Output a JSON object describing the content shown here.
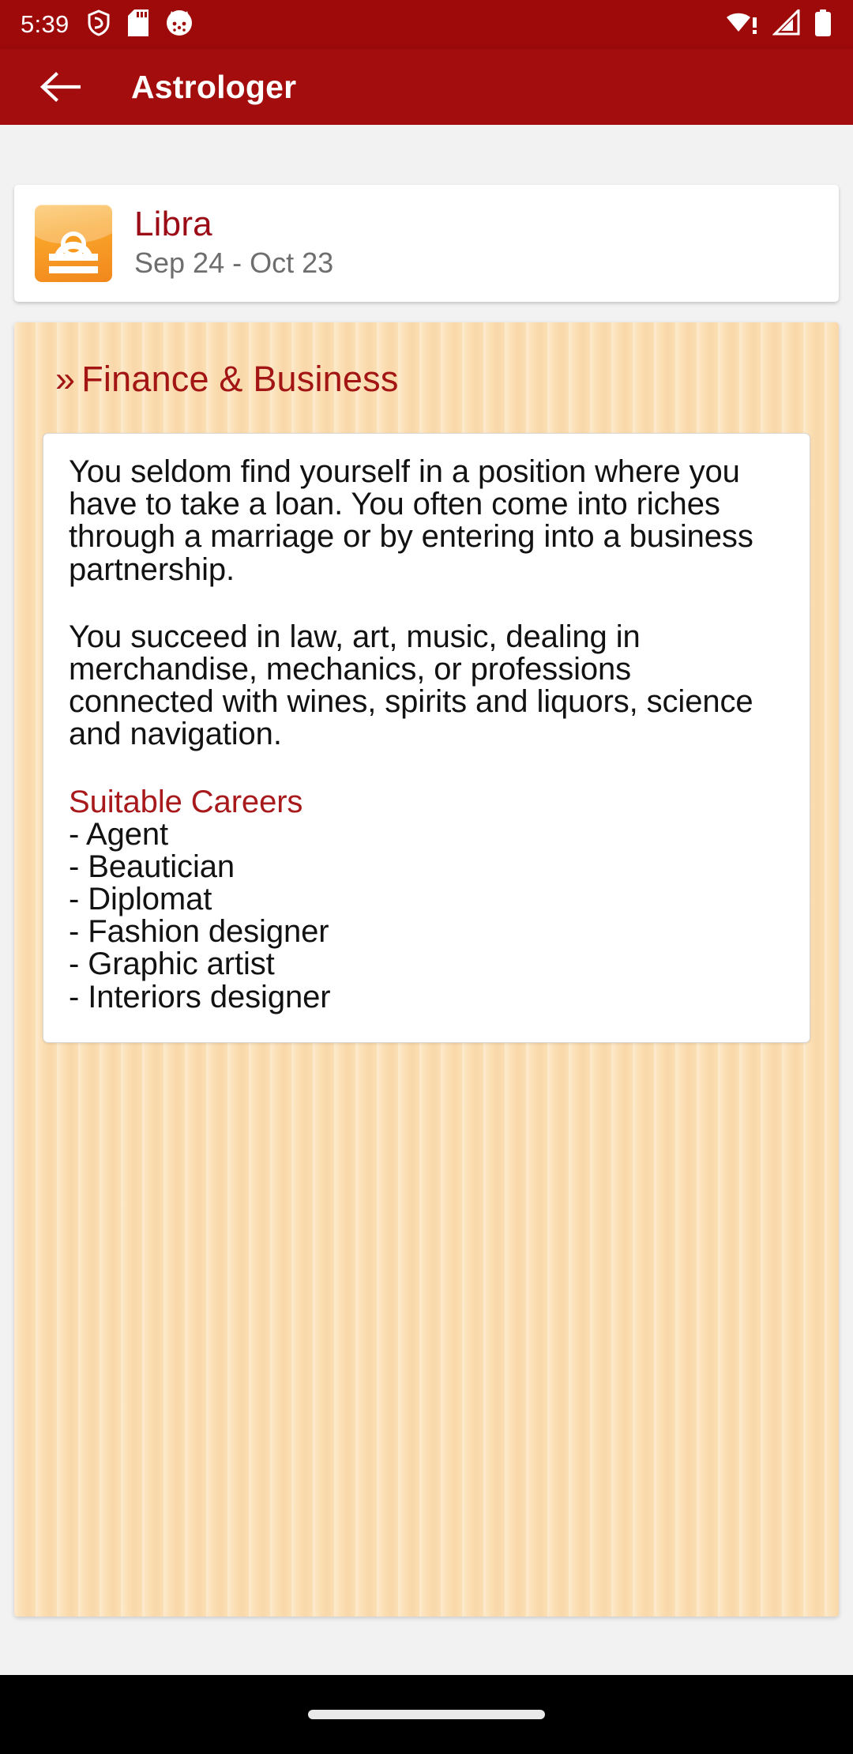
{
  "statusbar": {
    "time": "5:39",
    "left_icons": [
      "shield-icon",
      "sd-card-icon",
      "cat-app-icon"
    ],
    "right_icons": [
      "wifi-alert-icon",
      "cellular-signal-icon",
      "battery-icon"
    ],
    "background_color": "#9e0a0a"
  },
  "appbar": {
    "back_label": "back-arrow",
    "title": "Astrologer",
    "background_color": "#a30d0d"
  },
  "sign_card": {
    "icon": "libra-scales-icon",
    "name": "Libra",
    "dates": "Sep 24 - Oct 23",
    "name_color": "#9b0b16",
    "icon_color": "#f59a1e"
  },
  "panel": {
    "background_color": "#fbdfb4",
    "section": {
      "chevron": "»",
      "title": "Finance & Business",
      "title_color": "#a31515"
    },
    "content": {
      "paragraphs": [
        "You seldom find yourself in a position where you have to take a loan. You often come into riches through a marriage or by entering into a business partnership.",
        "You succeed in law, art, music, dealing in merchandise, mechanics, or professions connected with wines, spirits and liquors, science and navigation."
      ],
      "careers_heading": "Suitable Careers",
      "careers_heading_color": "#a8191c",
      "careers": [
        "- Agent",
        "- Beautician",
        "- Diplomat",
        "- Fashion designer",
        "- Graphic artist",
        "- Interiors designer"
      ]
    }
  },
  "navbar": {
    "gesture_pill": "home-gesture-pill"
  }
}
